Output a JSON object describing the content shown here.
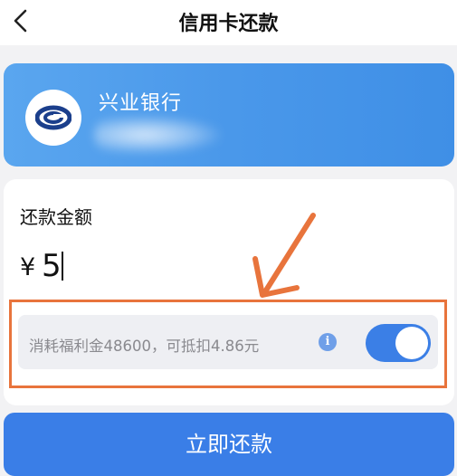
{
  "header": {
    "title": "信用卡还款",
    "back_icon": "chevron-left-icon"
  },
  "bank_card": {
    "bank_name": "兴业银行",
    "logo_icon": "industrial-bank-logo",
    "accent_color": "#4a98ea"
  },
  "amount_section": {
    "label": "还款金额",
    "currency_symbol": "¥",
    "value": "5"
  },
  "deduction_option": {
    "text": "消耗福利金48600，可抵扣4.86元",
    "info_icon_glyph": "i",
    "toggle_on": true,
    "toggle_color": "#3b7fe6"
  },
  "actions": {
    "pay_button_label": "立即还款",
    "button_color": "#3a7ee7"
  },
  "annotation": {
    "color": "#e8743c"
  }
}
